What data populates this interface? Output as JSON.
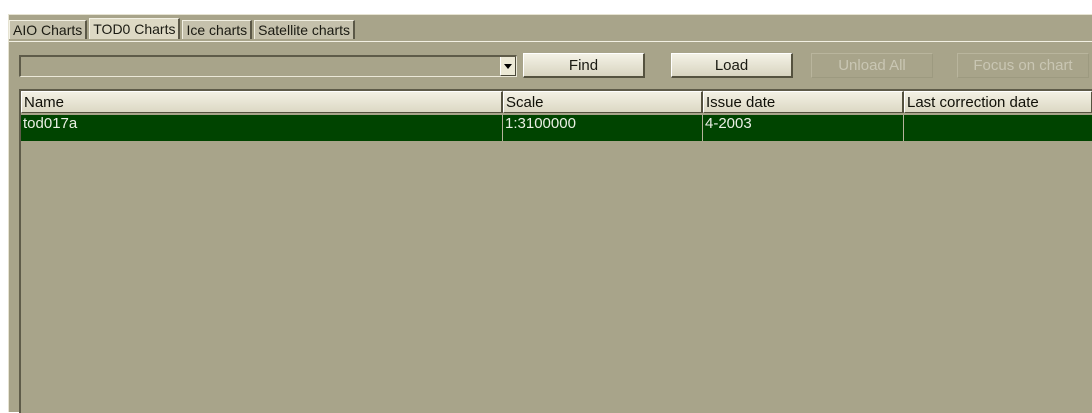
{
  "tabs": [
    {
      "label": "AIO Charts",
      "active": false
    },
    {
      "label": "TOD0 Charts",
      "active": true
    },
    {
      "label": "Ice charts",
      "active": false
    },
    {
      "label": "Satellite charts",
      "active": false
    }
  ],
  "toolbar": {
    "combo_value": "",
    "find_label": "Find",
    "load_label": "Load",
    "unload_all_label": "Unload All",
    "focus_label": "Focus on chart"
  },
  "table": {
    "columns": [
      "Name",
      "Scale",
      "Issue date",
      "Last correction date"
    ],
    "rows": [
      {
        "name": "tod017a",
        "scale": "1:3100000",
        "issue_date": "4-2003",
        "last_correction": ""
      }
    ]
  },
  "colors": {
    "panel": "#a8a48a",
    "selected_row": "#004400",
    "selected_text": "#e9efe3"
  }
}
